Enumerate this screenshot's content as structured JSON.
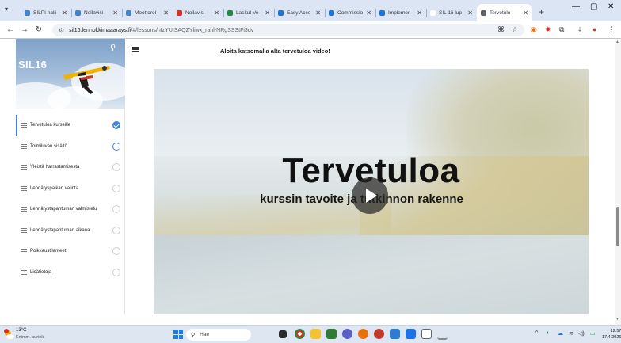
{
  "browser": {
    "tabs": [
      {
        "title": "SILPI halli",
        "color": "#3f83d1",
        "active": false
      },
      {
        "title": "Nollavisi",
        "color": "#3f83d1",
        "active": false
      },
      {
        "title": "Moottorol",
        "color": "#3f83d1",
        "active": false
      },
      {
        "title": "Nollavisi",
        "color": "#d93025",
        "active": false
      },
      {
        "title": "Laskut Ve",
        "color": "#1e8e3e",
        "active": false
      },
      {
        "title": "Easy Acco",
        "color": "#1a73e8",
        "active": false
      },
      {
        "title": "Commissio",
        "color": "#1a73e8",
        "active": false
      },
      {
        "title": "Implemen",
        "color": "#1a73e8",
        "active": false
      },
      {
        "title": "SIL 16 lup",
        "color": "#ffffff",
        "active": false
      },
      {
        "title": "Tervetulo",
        "color": "#5f6368",
        "active": true
      }
    ],
    "new_tab": "+",
    "url_host": "sil16.lennokkimaaarays.fi",
    "url_path": "/#/lessons/hIzYUISAQZYliwx_rahl-NRgSSStFi3dv"
  },
  "sidebar": {
    "title": "SIL16",
    "lessons": [
      {
        "label": "Tervetuloa kurssille",
        "status": "done"
      },
      {
        "label": "Toimiluvan sisältö",
        "status": "progress"
      },
      {
        "label": "Yleistä harrastamisesta",
        "status": "todo"
      },
      {
        "label": "Lennätyspaikan valinta",
        "status": "todo"
      },
      {
        "label": "Lennätystapahtuman valmistelu",
        "status": "todo"
      },
      {
        "label": "Lennätystapahtuman aikana",
        "status": "todo"
      },
      {
        "label": "Poikkeustilanteet",
        "status": "todo"
      },
      {
        "label": "Lisätietoja",
        "status": "todo"
      }
    ]
  },
  "content": {
    "heading": "Aloita katsomalla alta tervetuloa video!",
    "video": {
      "headline": "Tervetuloa",
      "subtitle": "kurssin tavoite ja tutkinnon rakenne"
    }
  },
  "taskbar": {
    "temperature": "13°C",
    "condition": "Enimm. aurink.",
    "search_placeholder": "Hae",
    "time": "12.57",
    "date": "17.4.2026"
  }
}
